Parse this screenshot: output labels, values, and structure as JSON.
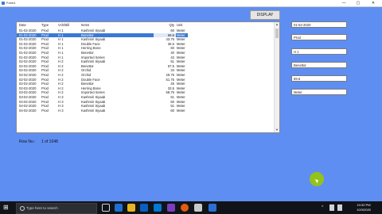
{
  "window": {
    "title": "Form1",
    "controls": [
      "—",
      "▢",
      "✕"
    ]
  },
  "display_button": "DISPLAY",
  "grid": {
    "columns": [
      "Date",
      "Type",
      "Vch/Bill",
      "Items",
      "Qty",
      "Unit"
    ],
    "rows": [
      [
        "01-02-2020",
        "Prod",
        "H 1",
        "Kashmiri Siyaab",
        "60",
        "Meter"
      ],
      [
        "01-02-2020",
        "Prod",
        "H 1",
        "Benettor",
        "69.6",
        "Meter"
      ],
      [
        "01-02-2020",
        "Prod",
        "H 1",
        "Kashmiri Siyaab",
        "43.75",
        "Meter"
      ],
      [
        "01-02-2020",
        "Prod",
        "H 1",
        "Double Face",
        "36.5",
        "Meter"
      ],
      [
        "01-02-2020",
        "Prod",
        "H 1",
        "Herring Bone",
        "60",
        "Meter"
      ],
      [
        "01-02-2020",
        "Prod",
        "H 1",
        "Benettor",
        "40",
        "Meter"
      ],
      [
        "01-02-2020",
        "Prod",
        "H 1",
        "Imported Series",
        "42",
        "Meter"
      ],
      [
        "02-02-2020",
        "Prod",
        "H 2",
        "Kashmiri Siyaab",
        "51",
        "Meter"
      ],
      [
        "02-02-2020",
        "Prod",
        "H 2",
        "Benettor",
        "57.5",
        "Meter"
      ],
      [
        "02-02-2020",
        "Prod",
        "H 2",
        "Orchid",
        "34",
        "Meter"
      ],
      [
        "02-02-2020",
        "Prod",
        "H 2",
        "Orchid",
        "29.75",
        "Meter"
      ],
      [
        "02-02-2020",
        "Prod",
        "H 2",
        "Double Face",
        "51.75",
        "Meter"
      ],
      [
        "02-02-2020",
        "Prod",
        "H 2",
        "Benettor",
        "45",
        "Meter"
      ],
      [
        "02-02-2020",
        "Prod",
        "H 2",
        "Herring Bone",
        "33.5",
        "Meter"
      ],
      [
        "03-02-2020",
        "Prod",
        "H 2",
        "Imported Series",
        "58.75",
        "Meter"
      ],
      [
        "03-02-2020",
        "Prod",
        "H 3",
        "Kashmiri Siyaab",
        "51",
        "Meter"
      ],
      [
        "04-02-2020",
        "Prod",
        "H 3",
        "Kashmiri Siyaab",
        "60",
        "Meter"
      ],
      [
        "04-02-2020",
        "Prod",
        "H 3",
        "Kashmiri Siyaab",
        "51",
        "Meter"
      ],
      [
        "04-02-2020",
        "Prod",
        "H 3",
        "Kashmiri Siyaab",
        "60",
        "Meter"
      ]
    ],
    "selected_row": 1
  },
  "fields": [
    "01-02-2020",
    "Prod",
    "H 1",
    "Benettor",
    "69.6",
    "Meter"
  ],
  "status": {
    "label": "Row No.:",
    "value": "1 of 1048"
  },
  "taskbar": {
    "search_placeholder": "Type here to search",
    "clock_time": "10:32 PM",
    "clock_date": "10/3/2020"
  },
  "colors": {
    "background": "#5f8ef2",
    "selection": "#3a78d6",
    "cursor": "#93c31a"
  }
}
